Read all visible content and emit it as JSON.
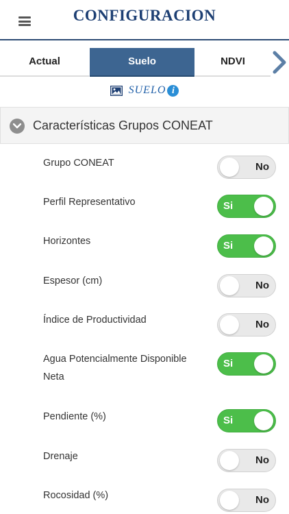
{
  "header": {
    "title": "CONFIGURACION",
    "title_color": "#1d3f73"
  },
  "tabs": [
    {
      "label": "Actual",
      "active": false
    },
    {
      "label": "Suelo",
      "active": true
    },
    {
      "label": "NDVI",
      "active": false
    }
  ],
  "section": {
    "label": "SUELO",
    "info_glyph": "i"
  },
  "accordion": {
    "label": "Características Grupos CONEAT",
    "expanded": true
  },
  "options": [
    {
      "label": "Grupo CONEAT",
      "state": "No",
      "on": false
    },
    {
      "label": "Perfil Representativo",
      "state": "Si",
      "on": true
    },
    {
      "label": "Horizontes",
      "state": "Si",
      "on": true
    },
    {
      "label": "Espesor (cm)",
      "state": "No",
      "on": false
    },
    {
      "label": "Índice de Productividad",
      "state": "No",
      "on": false
    },
    {
      "label": "Agua Potencialmente Disponible Neta",
      "state": "Si",
      "on": true
    },
    {
      "label": "Pendiente (%)",
      "state": "Si",
      "on": true
    },
    {
      "label": "Drenaje",
      "state": "No",
      "on": false
    },
    {
      "label": "Rocosidad (%)",
      "state": "No",
      "on": false
    }
  ],
  "colors": {
    "accent": "#3d6591",
    "toggle_on": "#4cbe4a",
    "toggle_off": "#e9e9e9",
    "link": "#1f5fa8"
  }
}
